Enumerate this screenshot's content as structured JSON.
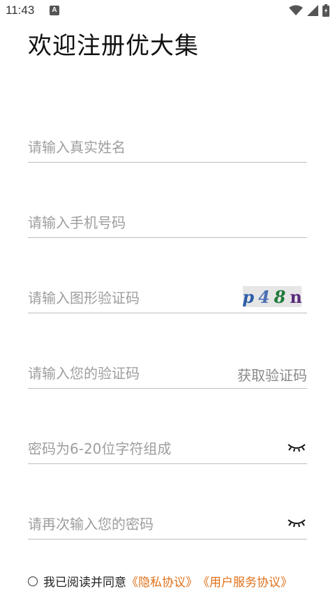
{
  "status_bar": {
    "time": "11:43",
    "notification_icon": "A"
  },
  "header": {
    "title": "欢迎注册优大集"
  },
  "form": {
    "name_placeholder": "请输入真实姓名",
    "phone_placeholder": "请输入手机号码",
    "captcha_placeholder": "请输入图形验证码",
    "captcha_text": [
      "p",
      "4",
      "8",
      "n"
    ],
    "code_placeholder": "请输入您的验证码",
    "get_code_label": "获取验证码",
    "password_placeholder": "密码为6-20位字符组成",
    "confirm_password_placeholder": "请再次输入您的密码"
  },
  "agreement": {
    "text": "我已阅读并同意",
    "privacy_label": "《隐私协议》",
    "service_label": "《用户服务协议》"
  },
  "colors": {
    "link": "#e0701a",
    "placeholder": "#9e9e9e",
    "divider": "#bdbdbd"
  }
}
